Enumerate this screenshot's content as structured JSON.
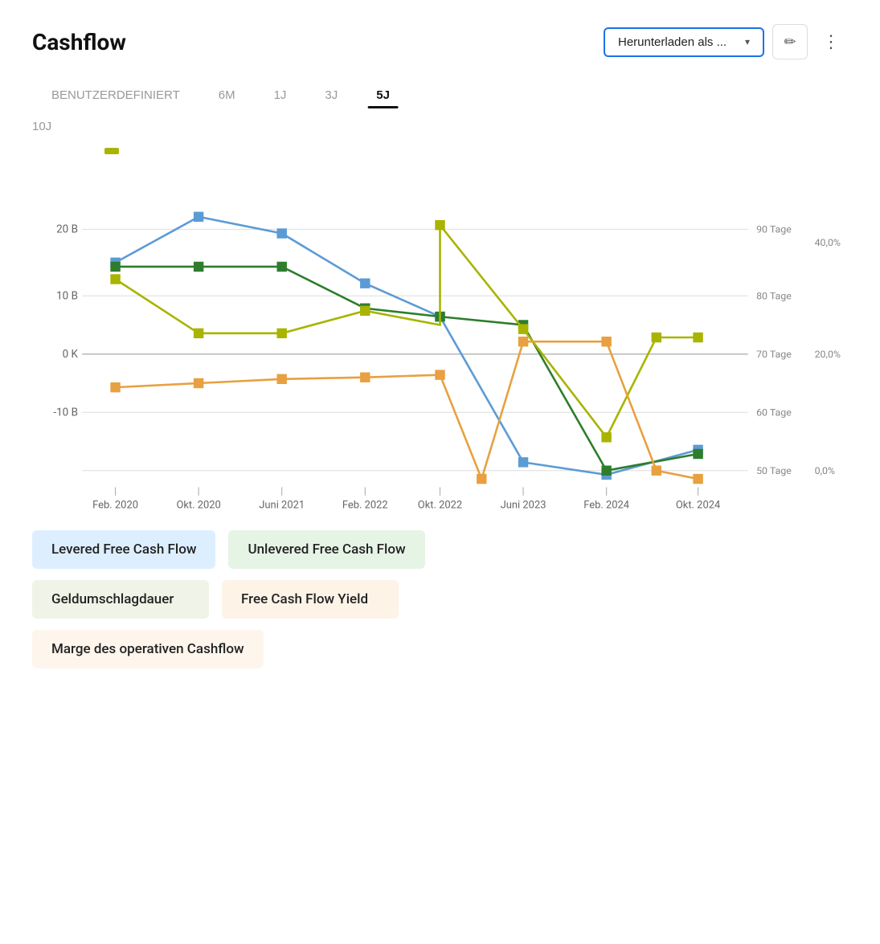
{
  "header": {
    "title": "Cashflow",
    "download_label": "Herunterladen als ...",
    "edit_icon": "✏",
    "more_icon": "⋮"
  },
  "time_tabs": {
    "row1": [
      {
        "id": "custom",
        "label": "BENUTZERDEFINIERT",
        "active": false
      },
      {
        "id": "6m",
        "label": "6M",
        "active": false
      },
      {
        "id": "1j",
        "label": "1J",
        "active": false
      },
      {
        "id": "3j",
        "label": "3J",
        "active": false
      },
      {
        "id": "5j",
        "label": "5J",
        "active": true
      }
    ],
    "row2": [
      {
        "id": "10j",
        "label": "10J",
        "active": false
      }
    ]
  },
  "chart": {
    "y_axis_left": [
      "20 B",
      "10 B",
      "0 K",
      "-10 B"
    ],
    "y_axis_right_tage": [
      "90 Tage",
      "80 Tage",
      "70 Tage",
      "60 Tage",
      "50 Tage"
    ],
    "y_axis_right_pct": [
      "40,0%",
      "20,0%",
      "0,0%"
    ],
    "x_labels": [
      "Feb. 2020",
      "Okt. 2020",
      "Juni 2021",
      "Feb. 2022",
      "Okt. 2022",
      "Juni 2023",
      "Feb. 2024",
      "Okt. 2024"
    ]
  },
  "legend": {
    "items": [
      {
        "id": "levered",
        "label": "Levered Free Cash Flow",
        "style": "blue"
      },
      {
        "id": "unlevered",
        "label": "Unlevered Free Cash Flow",
        "style": "green"
      },
      {
        "id": "geldumschlag",
        "label": "Geldumschlagdauer",
        "style": "dark-green"
      },
      {
        "id": "fcf-yield",
        "label": "Free Cash Flow Yield",
        "style": "orange"
      },
      {
        "id": "marge",
        "label": "Marge des operativen Cashflow",
        "style": "light-orange"
      }
    ]
  }
}
